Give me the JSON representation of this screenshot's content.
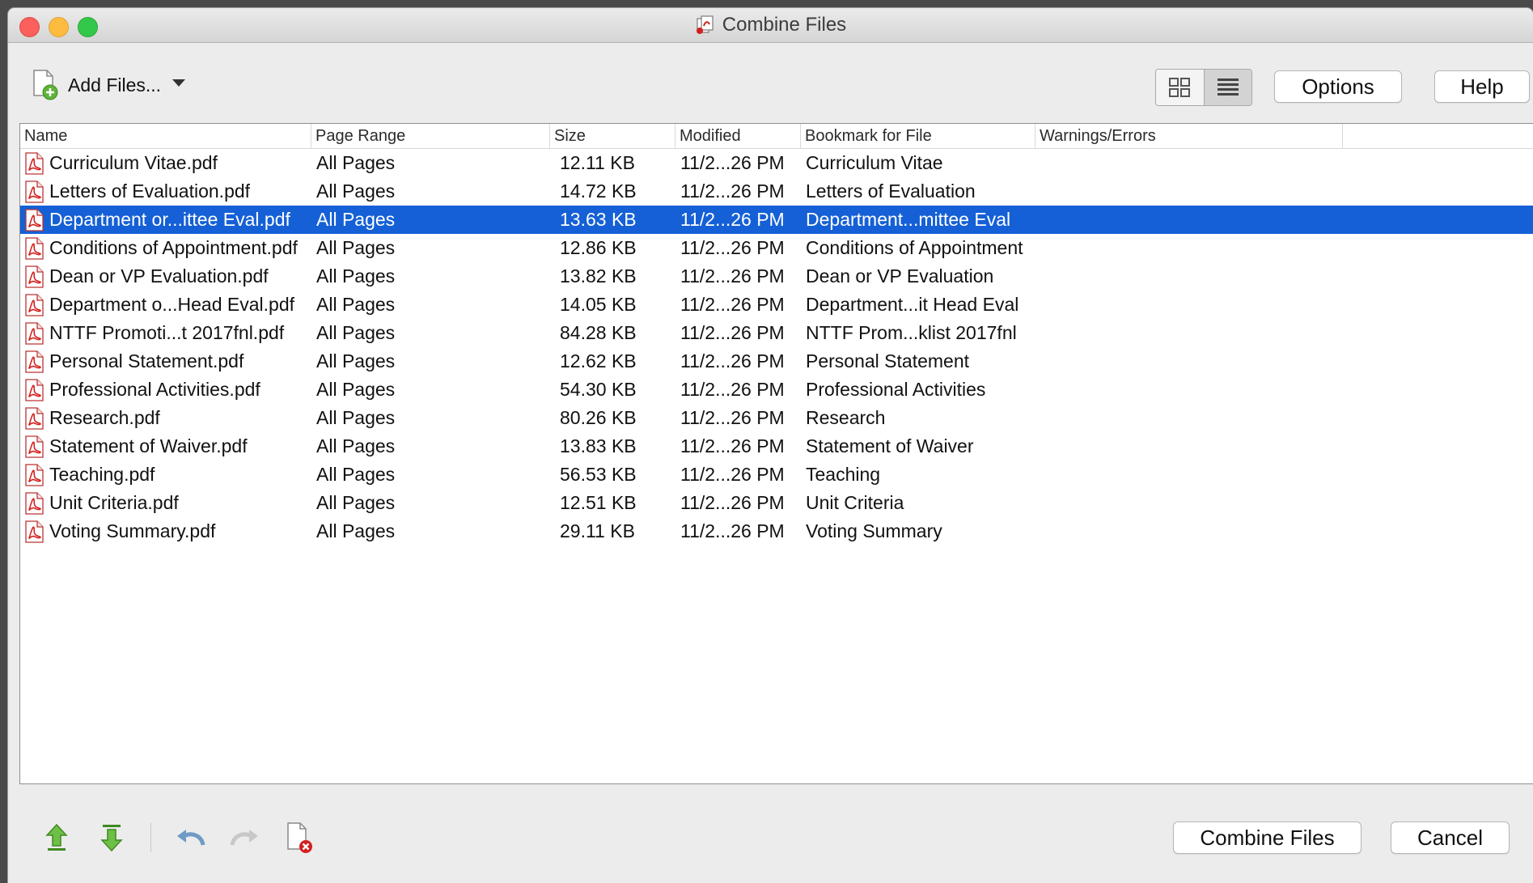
{
  "window": {
    "title": "Combine Files",
    "title_icon": "combine-files-icon"
  },
  "toolbar": {
    "add_files_label": "Add Files...",
    "add_files_icon": "add-file-icon",
    "options_label": "Options",
    "help_label": "Help",
    "view_modes": [
      "thumbnail-grid-icon",
      "list-view-icon"
    ],
    "active_view": "list"
  },
  "table": {
    "columns": [
      "Name",
      "Page Range",
      "Size",
      "Modified",
      "Bookmark for File",
      "Warnings/Errors"
    ],
    "selected_row": 2,
    "rows": [
      {
        "name": "Curriculum Vitae.pdf",
        "range": "All Pages",
        "size": "12.11 KB",
        "modified": "11/2...26 PM",
        "bookmark": "Curriculum Vitae",
        "warnings": ""
      },
      {
        "name": "Letters of Evaluation.pdf",
        "range": "All Pages",
        "size": "14.72 KB",
        "modified": "11/2...26 PM",
        "bookmark": "Letters of Evaluation",
        "warnings": ""
      },
      {
        "name": "Department or...ittee Eval.pdf",
        "range": "All Pages",
        "size": "13.63 KB",
        "modified": "11/2...26 PM",
        "bookmark": "Department...mittee Eval",
        "warnings": ""
      },
      {
        "name": "Conditions of Appointment.pdf",
        "range": "All Pages",
        "size": "12.86 KB",
        "modified": "11/2...26 PM",
        "bookmark": "Conditions of Appointment",
        "warnings": ""
      },
      {
        "name": "Dean or VP Evaluation.pdf",
        "range": "All Pages",
        "size": "13.82 KB",
        "modified": "11/2...26 PM",
        "bookmark": "Dean or VP Evaluation",
        "warnings": ""
      },
      {
        "name": "Department o...Head Eval.pdf",
        "range": "All Pages",
        "size": "14.05 KB",
        "modified": "11/2...26 PM",
        "bookmark": "Department...it Head Eval",
        "warnings": ""
      },
      {
        "name": "NTTF Promoti...t 2017fnl.pdf",
        "range": "All Pages",
        "size": "84.28 KB",
        "modified": "11/2...26 PM",
        "bookmark": "NTTF Prom...klist 2017fnl",
        "warnings": ""
      },
      {
        "name": "Personal Statement.pdf",
        "range": "All Pages",
        "size": "12.62 KB",
        "modified": "11/2...26 PM",
        "bookmark": "Personal Statement",
        "warnings": ""
      },
      {
        "name": "Professional Activities.pdf",
        "range": "All Pages",
        "size": "54.30 KB",
        "modified": "11/2...26 PM",
        "bookmark": "Professional Activities",
        "warnings": ""
      },
      {
        "name": "Research.pdf",
        "range": "All Pages",
        "size": "80.26 KB",
        "modified": "11/2...26 PM",
        "bookmark": "Research",
        "warnings": ""
      },
      {
        "name": "Statement of Waiver.pdf",
        "range": "All Pages",
        "size": "13.83 KB",
        "modified": "11/2...26 PM",
        "bookmark": "Statement of Waiver",
        "warnings": ""
      },
      {
        "name": "Teaching.pdf",
        "range": "All Pages",
        "size": "56.53 KB",
        "modified": "11/2...26 PM",
        "bookmark": "Teaching",
        "warnings": ""
      },
      {
        "name": "Unit Criteria.pdf",
        "range": "All Pages",
        "size": "12.51 KB",
        "modified": "11/2...26 PM",
        "bookmark": "Unit Criteria",
        "warnings": ""
      },
      {
        "name": "Voting Summary.pdf",
        "range": "All Pages",
        "size": "29.11 KB",
        "modified": "11/2...26 PM",
        "bookmark": "Voting Summary",
        "warnings": ""
      }
    ]
  },
  "footer": {
    "icons": [
      "move-up-icon",
      "move-down-icon",
      "undo-icon",
      "redo-icon",
      "remove-file-icon"
    ],
    "combine_label": "Combine Files",
    "cancel_label": "Cancel"
  },
  "colors": {
    "selection": "#1560d6",
    "pdf_red": "#d3201d",
    "arrow_green": "#5fb33a"
  }
}
